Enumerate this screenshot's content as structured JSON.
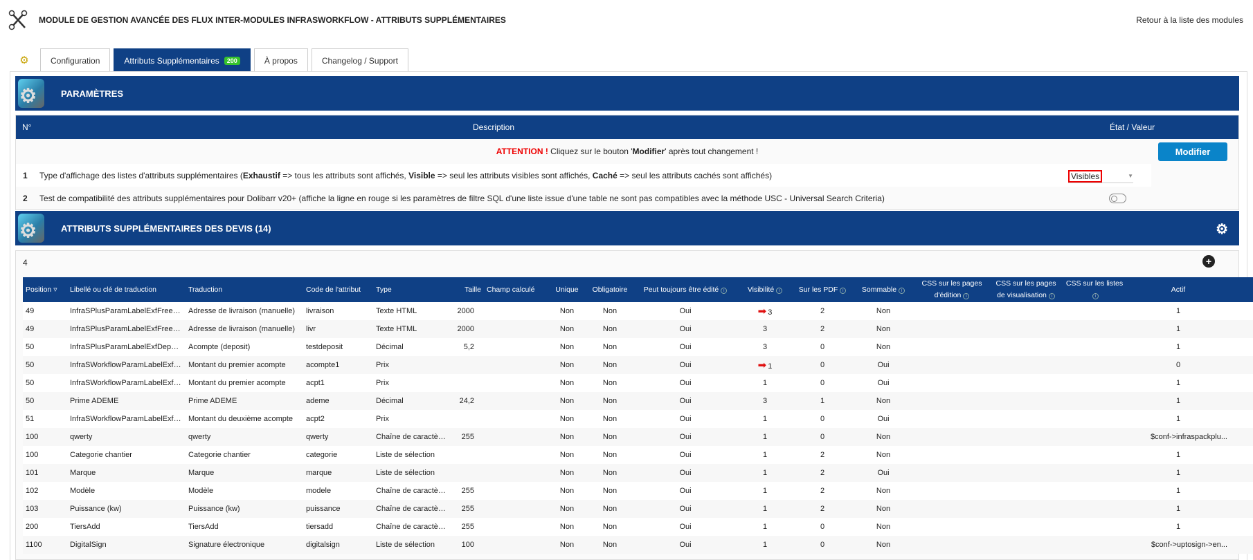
{
  "header": {
    "title": "MODULE DE GESTION AVANCÉE DES FLUX INTER-MODULES INFRASWORKFLOW - ATTRIBUTS SUPPLÉMENTAIRES",
    "back_link": "Retour à la liste des modules"
  },
  "tabs": [
    {
      "label": "Configuration"
    },
    {
      "label": "Attributs Supplémentaires",
      "badge": "200",
      "active": true
    },
    {
      "label": "À propos"
    },
    {
      "label": "Changelog / Support"
    }
  ],
  "params": {
    "title": "PARAMÈTRES",
    "col_no": "N°",
    "col_desc": "Description",
    "col_state": "État / Valeur",
    "attention": "ATTENTION !",
    "attention_text_1": " Cliquez sur le bouton '",
    "attention_bold": "Modifier",
    "attention_text_2": "' après tout changement !",
    "modify_button": "Modifier",
    "row1": {
      "no": "1",
      "t1": "Type d'affichage des listes d'attributs supplémentaires (",
      "b1": "Exhaustif",
      "t2": " => tous les attributs sont affichés, ",
      "b2": "Visible",
      "t3": " => seul les attributs visibles sont affichés, ",
      "b3": "Caché",
      "t4": " => seul les attributs cachés sont affichés)",
      "value": "Visibles"
    },
    "row2": {
      "no": "2",
      "text": "Test de compatibilité des attributs supplémentaires pour Dolibarr v20+ (affiche la ligne en rouge si les paramètres de filtre SQL d'une liste issue d'une table ne sont pas compatibles avec la méthode USC - Universal Search Criteria)",
      "toggle": false
    }
  },
  "devis": {
    "title": "ATTRIBUTS SUPPLÉMENTAIRES DES DEVIS (14)",
    "count": "4",
    "columns": [
      "Position ▿",
      "Libellé ou clé de traduction",
      "Traduction",
      "Code de l'attribut",
      "Type",
      "Taille",
      "Champ calculé",
      "Unique",
      "Obligatoire",
      "Peut toujours être édité",
      "Visibilité",
      "Sur les PDF",
      "Sommable",
      "CSS sur les pages d'édition",
      "CSS sur les pages de visualisation",
      "CSS sur les listes",
      "Actif"
    ],
    "rows": [
      [
        "49",
        "InfraSPlusParamLabelExfFreeAd...",
        "Adresse de livraison (manuelle)",
        "livraison",
        "Texte HTML",
        "2000",
        "",
        "Non",
        "Non",
        "Oui",
        "3",
        "2",
        "Non",
        "",
        "",
        "",
        "1"
      ],
      [
        "49",
        "InfraSPlusParamLabelExfFreeAd...",
        "Adresse de livraison (manuelle)",
        "livr",
        "Texte HTML",
        "2000",
        "",
        "Non",
        "Non",
        "Oui",
        "3",
        "2",
        "Non",
        "",
        "",
        "",
        "1"
      ],
      [
        "50",
        "InfraSPlusParamLabelExfDeposit",
        "Acompte (deposit)",
        "testdeposit",
        "Décimal",
        "5,2",
        "",
        "Non",
        "Non",
        "Oui",
        "3",
        "0",
        "Non",
        "",
        "",
        "",
        "1"
      ],
      [
        "50",
        "InfraSWorkflowParamLabelExfDe...",
        "Montant du premier acompte",
        "acompte1",
        "Prix",
        "",
        "",
        "Non",
        "Non",
        "Oui",
        "1",
        "0",
        "Oui",
        "",
        "",
        "",
        "0"
      ],
      [
        "50",
        "InfraSWorkflowParamLabelExfDe...",
        "Montant du premier acompte",
        "acpt1",
        "Prix",
        "",
        "",
        "Non",
        "Non",
        "Oui",
        "1",
        "0",
        "Oui",
        "",
        "",
        "",
        "1"
      ],
      [
        "50",
        "Prime ADEME",
        "Prime ADEME",
        "ademe",
        "Décimal",
        "24,2",
        "",
        "Non",
        "Non",
        "Oui",
        "3",
        "1",
        "Non",
        "",
        "",
        "",
        "1"
      ],
      [
        "51",
        "InfraSWorkflowParamLabelExfSe...",
        "Montant du deuxième acompte",
        "acpt2",
        "Prix",
        "",
        "",
        "Non",
        "Non",
        "Oui",
        "1",
        "0",
        "Oui",
        "",
        "",
        "",
        "1"
      ],
      [
        "100",
        "qwerty",
        "qwerty",
        "qwerty",
        "Chaîne de caractère...",
        "255",
        "",
        "Non",
        "Non",
        "Oui",
        "1",
        "0",
        "Non",
        "",
        "",
        "",
        "$conf->infraspackplu..."
      ],
      [
        "100",
        "Categorie chantier",
        "Categorie chantier",
        "categorie",
        "Liste de sélection",
        "",
        "",
        "Non",
        "Non",
        "Oui",
        "1",
        "2",
        "Non",
        "",
        "",
        "",
        "1"
      ],
      [
        "101",
        "Marque",
        "Marque",
        "marque",
        "Liste de sélection",
        "",
        "",
        "Non",
        "Non",
        "Oui",
        "1",
        "2",
        "Oui",
        "",
        "",
        "",
        "1"
      ],
      [
        "102",
        "Modèle",
        "Modèle",
        "modele",
        "Chaîne de caractère...",
        "255",
        "",
        "Non",
        "Non",
        "Oui",
        "1",
        "2",
        "Non",
        "",
        "",
        "",
        "1"
      ],
      [
        "103",
        "Puissance (kw)",
        "Puissance (kw)",
        "puissance",
        "Chaîne de caractère...",
        "255",
        "",
        "Non",
        "Non",
        "Oui",
        "1",
        "2",
        "Non",
        "",
        "",
        "",
        "1"
      ],
      [
        "200",
        "TiersAdd",
        "TiersAdd",
        "tiersadd",
        "Chaîne de caractère...",
        "255",
        "",
        "Non",
        "Non",
        "Oui",
        "1",
        "0",
        "Non",
        "",
        "",
        "",
        "1"
      ],
      [
        "1100",
        "DigitalSign",
        "Signature électronique",
        "digitalsign",
        "Liste de sélection",
        "100",
        "",
        "Non",
        "Non",
        "Oui",
        "1",
        "0",
        "Non",
        "",
        "",
        "",
        "$conf->uptosign->en..."
      ]
    ],
    "arrow_rows": [
      0,
      3
    ],
    "arrow_color": "#e01010"
  },
  "colors": {
    "navy": "#0f4085",
    "button": "#0a84c9",
    "badge": "#36c22c"
  }
}
